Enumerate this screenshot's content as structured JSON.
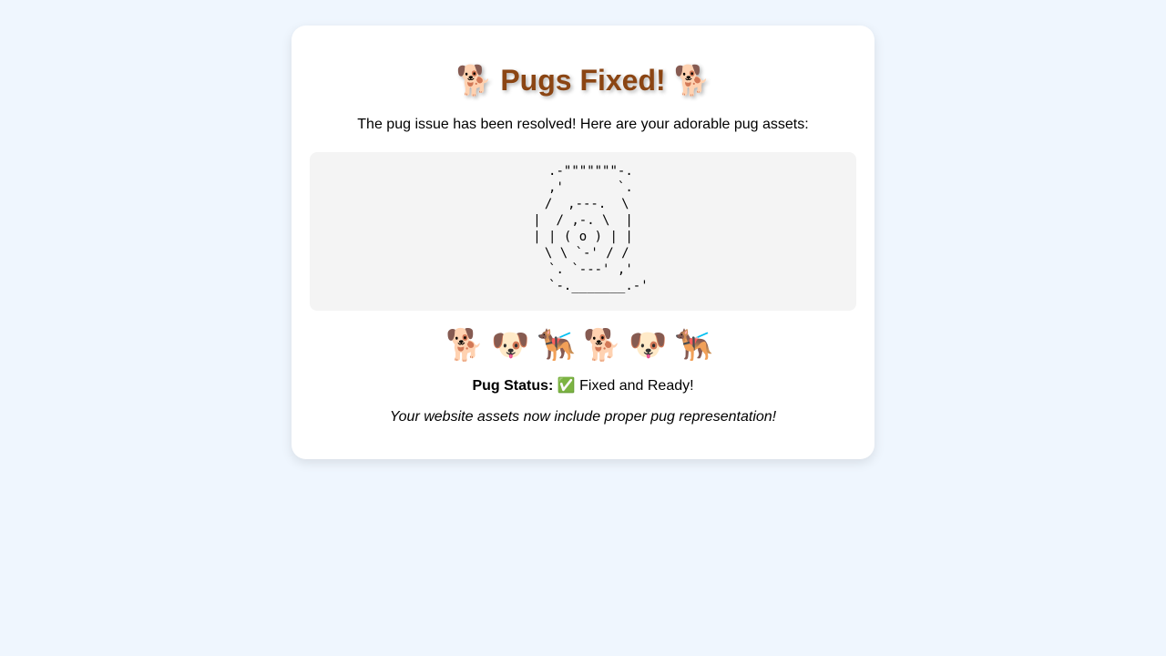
{
  "header": {
    "emoji_left": "🐕",
    "title": "Pugs Fixed!",
    "emoji_right": "🐕"
  },
  "intro": "The pug issue has been resolved! Here are your adorable pug assets:",
  "ascii_art": "  .-\"\"\"\"\"\"\"-.\n  ,'       `.\n /  ,---.  \\\n|  / ,-. \\  |\n| | ( o ) | |\n \\ \\ `-' / /\n  `. `---' ,'\n    `-._______.-'",
  "emoji_row": [
    "🐕",
    "🐶",
    "🐕‍🦺",
    "🐕",
    "🐶",
    "🐕‍🦺"
  ],
  "status": {
    "label": "Pug Status:",
    "icon": "✅",
    "value": "Fixed and Ready!"
  },
  "footer": "Your website assets now include proper pug representation!"
}
